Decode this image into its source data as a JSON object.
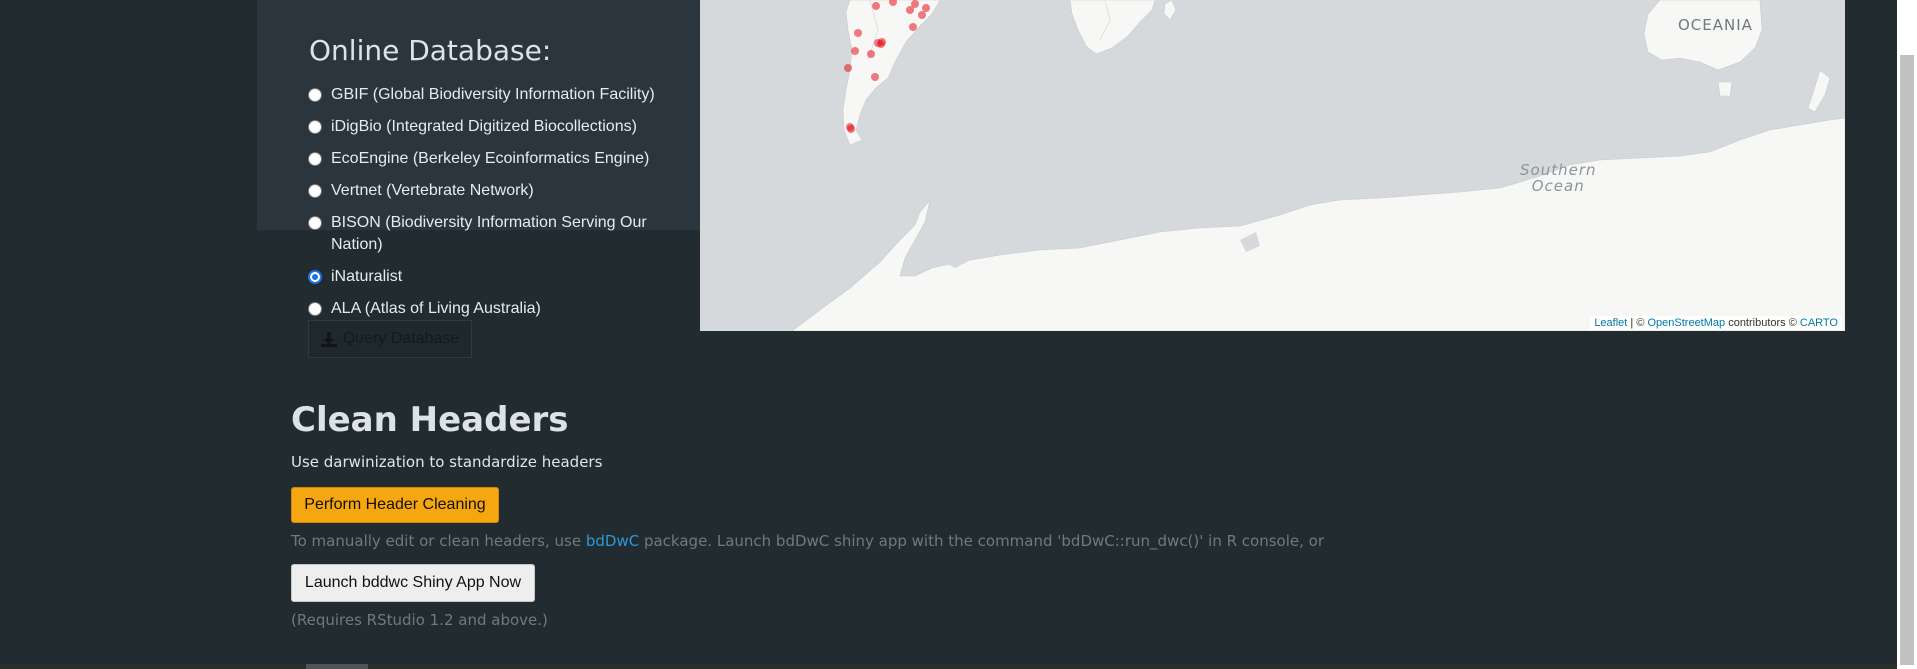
{
  "online_db": {
    "title": "Online Database:",
    "options": [
      {
        "label": "GBIF (Global Biodiversity Information Facility)",
        "checked": false
      },
      {
        "label": "iDigBio (Integrated Digitized Biocollections)",
        "checked": false
      },
      {
        "label": "EcoEngine (Berkeley Ecoinformatics Engine)",
        "checked": false
      },
      {
        "label": "Vertnet (Vertebrate Network)",
        "checked": false
      },
      {
        "label": "BISON (Biodiversity Information Serving Our Nation)",
        "checked": false
      },
      {
        "label": "iNaturalist",
        "checked": true
      },
      {
        "label": "ALA (Atlas of Living Australia)",
        "checked": false
      }
    ],
    "query_button": "Query Database",
    "query_icon": "download-icon"
  },
  "map": {
    "labels": {
      "oceania": "OCEANIA",
      "southern_ocean_1": "Southern",
      "southern_ocean_2": "Ocean"
    },
    "attribution": {
      "leaflet": "Leaflet",
      "sep": " | © ",
      "osm": "OpenStreetMap",
      "contrib": " contributors © ",
      "carto": "CARTO"
    },
    "point_color": "#e8101a",
    "land_color": "#f7f7f5",
    "water_color": "#d6d9db"
  },
  "clean_headers": {
    "title": "Clean Headers",
    "description": "Use darwinization to standardize headers",
    "perform_button": "Perform Header Cleaning",
    "manual_pre": "To manually edit or clean headers, use ",
    "manual_link": "bdDwC",
    "manual_post": " package. Launch bdDwC shiny app with the command 'bdDwC::run_dwc()' in R console, or",
    "launch_button": "Launch bddwc Shiny App Now",
    "requirement": "(Requires RStudio 1.2 and above.)"
  },
  "colors": {
    "background": "#222c30",
    "panel": "#2b353d",
    "warning_button": "#f6a60f",
    "link": "#2c99d8"
  }
}
